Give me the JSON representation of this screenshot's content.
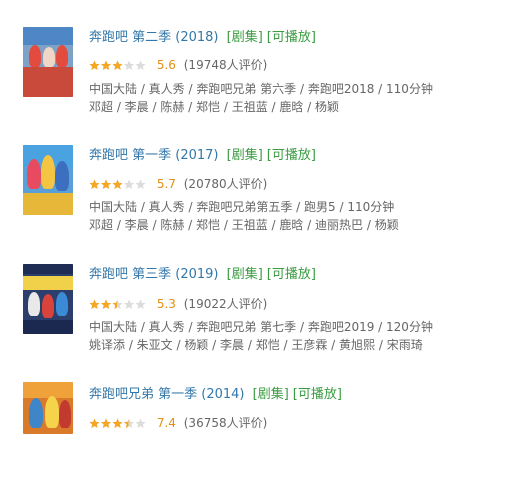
{
  "results": [
    {
      "title": "奔跑吧 第二季 (2018)",
      "tags": [
        "[剧集]",
        "[可播放]"
      ],
      "rating": 5.6,
      "score": "5.6",
      "count": "(19748人评价)",
      "meta": "中国大陆 / 真人秀 / 奔跑吧兄弟 第六季 / 奔跑吧2018 / 110分钟",
      "cast": "邓超 / 李晨 / 陈赫 / 郑恺 / 王祖蓝 / 鹿晗 / 杨颖"
    },
    {
      "title": "奔跑吧 第一季 (2017)",
      "tags": [
        "[剧集]",
        "[可播放]"
      ],
      "rating": 5.7,
      "score": "5.7",
      "count": "(20780人评价)",
      "meta": "中国大陆 / 真人秀 / 奔跑吧兄弟第五季 / 跑男5 / 110分钟",
      "cast": "邓超 / 李晨 / 陈赫 / 郑恺 / 王祖蓝 / 鹿晗 / 迪丽热巴 / 杨颖"
    },
    {
      "title": "奔跑吧 第三季 (2019)",
      "tags": [
        "[剧集]",
        "[可播放]"
      ],
      "rating": 5.3,
      "score": "5.3",
      "count": "(19022人评价)",
      "meta": "中国大陆 / 真人秀 / 奔跑吧兄弟 第七季 / 奔跑吧2019 / 120分钟",
      "cast": "姚译添 / 朱亚文 / 杨颖 / 李晨 / 郑恺 / 王彦霖 / 黄旭熙 / 宋雨琦"
    },
    {
      "title": "奔跑吧兄弟 第一季 (2014)",
      "tags": [
        "[剧集]",
        "[可播放]"
      ],
      "rating": 7.4,
      "score": "7.4",
      "count": "(36758人评价)",
      "meta": "",
      "cast": ""
    }
  ],
  "colors": {
    "title": "#3377aa",
    "tag": "#3b9c42",
    "score": "#e09015",
    "meta": "#666666",
    "star_on": "#f5a623",
    "star_off": "#dcdcdc"
  }
}
